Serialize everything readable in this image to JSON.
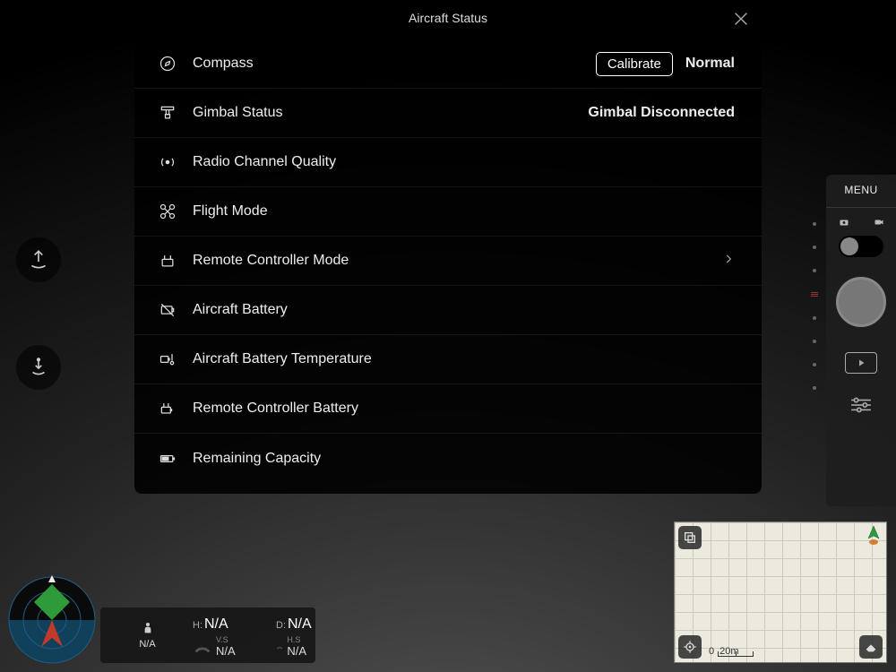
{
  "modal": {
    "title": "Aircraft Status",
    "rows": {
      "compass": {
        "label": "Compass",
        "button": "Calibrate",
        "value": "Normal"
      },
      "gimbal": {
        "label": "Gimbal Status",
        "value": "Gimbal Disconnected"
      },
      "radio": {
        "label": "Radio Channel Quality"
      },
      "flight_mode": {
        "label": "Flight Mode"
      },
      "rc_mode": {
        "label": "Remote Controller Mode"
      },
      "battery": {
        "label": "Aircraft Battery"
      },
      "battery_temp": {
        "label": "Aircraft Battery Temperature"
      },
      "rc_battery": {
        "label": "Remote Controller Battery"
      },
      "capacity": {
        "label": "Remaining Capacity"
      }
    }
  },
  "camera": {
    "menu_label": "MENU"
  },
  "telemetry": {
    "height_key": "H:",
    "height_val": "N/A",
    "distance_key": "D:",
    "distance_val": "N/A",
    "vs_key": "V.S",
    "vs_val": "N/A",
    "hs_key": "H.S",
    "hs_val": "N/A",
    "att_val": "N/A"
  },
  "map": {
    "scale_zero": "0",
    "scale_label": "20m"
  }
}
